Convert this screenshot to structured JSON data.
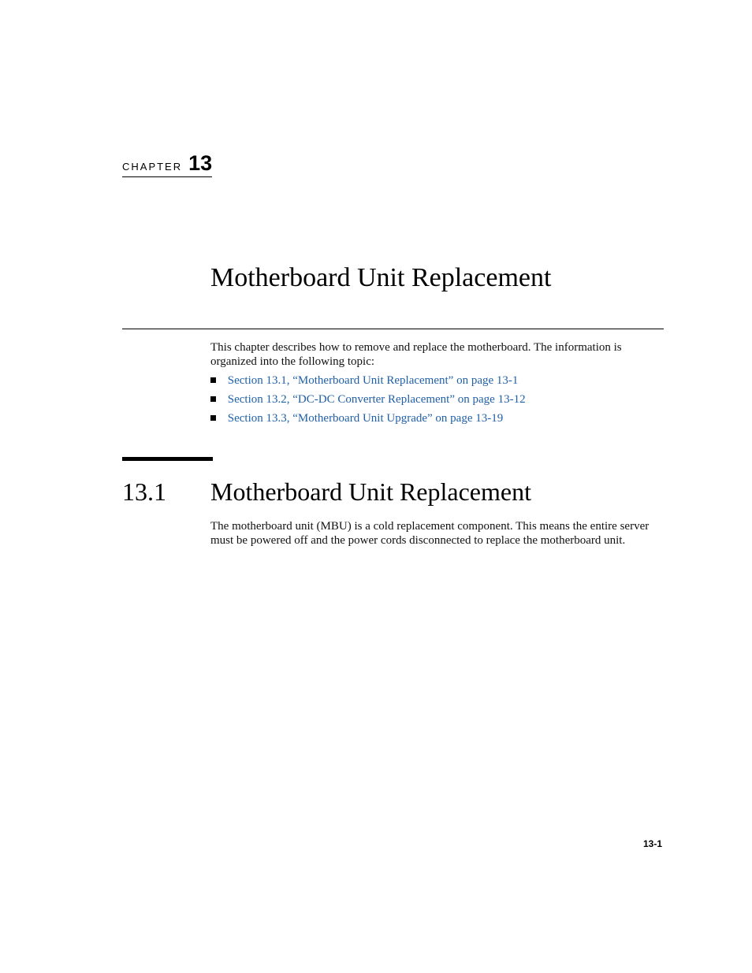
{
  "chapter": {
    "label": "CHAPTER",
    "number": "13",
    "title": "Motherboard Unit Replacement"
  },
  "intro": {
    "text": "This chapter describes how to remove and replace the motherboard. The information is organized into the following topic:",
    "toc": [
      {
        "label": "Section 13.1, “Motherboard Unit Replacement” on page 13-1"
      },
      {
        "label": "Section 13.2, “DC-DC Converter Replacement” on page 13-12"
      },
      {
        "label": "Section 13.3, “Motherboard Unit Upgrade” on page 13-19"
      }
    ]
  },
  "section": {
    "number": "13.1",
    "title": "Motherboard Unit Replacement",
    "body": "The motherboard unit (MBU) is a cold replacement component. This means the entire server must be powered off and the power cords disconnected to replace the motherboard unit."
  },
  "footer": {
    "page_number": "13-1"
  },
  "colors": {
    "link": "#1f5fa8"
  }
}
